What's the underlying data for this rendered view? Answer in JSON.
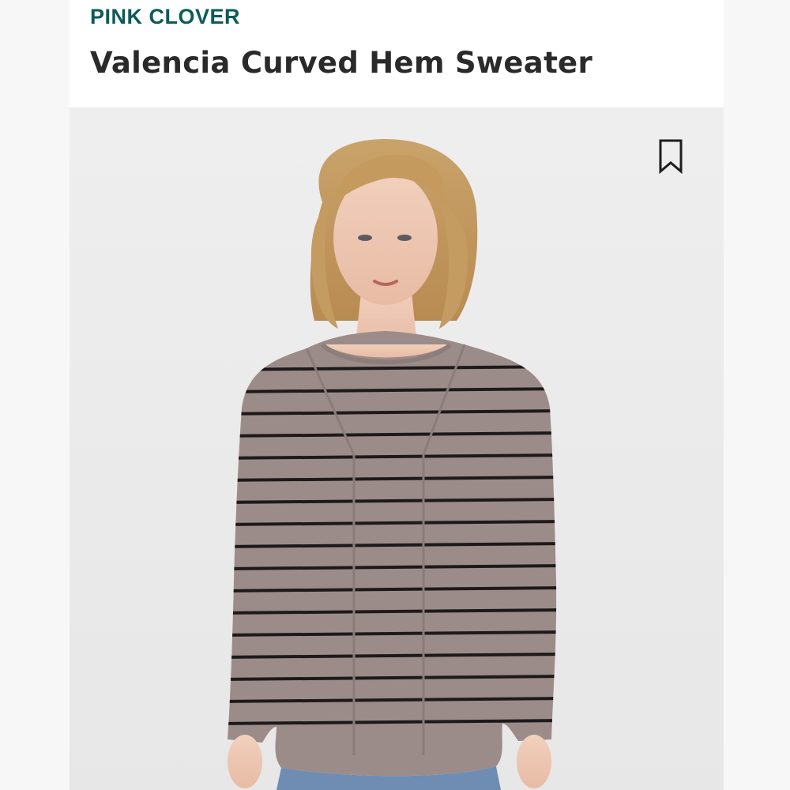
{
  "product": {
    "brand": "PINK CLOVER",
    "title": "Valencia Curved Hem Sweater"
  },
  "image": {
    "icon": "bookmark-icon",
    "description_icon": "product-photo"
  },
  "colors": {
    "brand": "#0c5b57",
    "title": "#2a2a2a",
    "photo_background": "#ececec",
    "sweater": "#9c8c89",
    "stripes": "#1d1a1b"
  }
}
